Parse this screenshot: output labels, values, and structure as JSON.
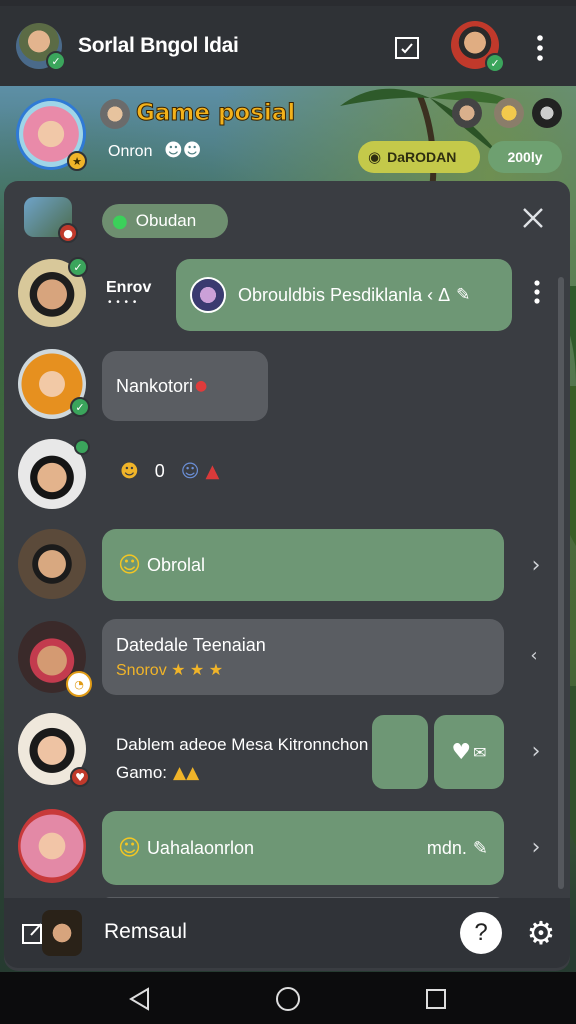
{
  "app": {
    "title": "Sorlal Bngol ldai",
    "accent_green": "#6e9775",
    "bubble_grey": "#5a5d62"
  },
  "hero": {
    "game_title": "Game posial",
    "subtitle": "Onron",
    "pill_left": "DaRODAN",
    "pill_right": "200ly"
  },
  "panel": {
    "chip_label": "Obudan",
    "rows": [
      {
        "name": "Enrov",
        "dots": "• • • •",
        "message": "Obrouldbis Pesdiklanla ‹ Δ",
        "icon": "pencil-icon"
      },
      {
        "message": "Nankotori"
      },
      {
        "message": "0"
      },
      {
        "message": "Obrolal"
      },
      {
        "title": "Datedale Teenaian",
        "subtitle": "Snorov ★ ★ ★"
      },
      {
        "title": "Dablem adeoe Mesa Kitronnchon",
        "subtitle": "Gamo:"
      },
      {
        "message": "Uahalaonrlon",
        "trailing": "mdn."
      }
    ]
  },
  "bottombar": {
    "label": "Remsaul"
  }
}
